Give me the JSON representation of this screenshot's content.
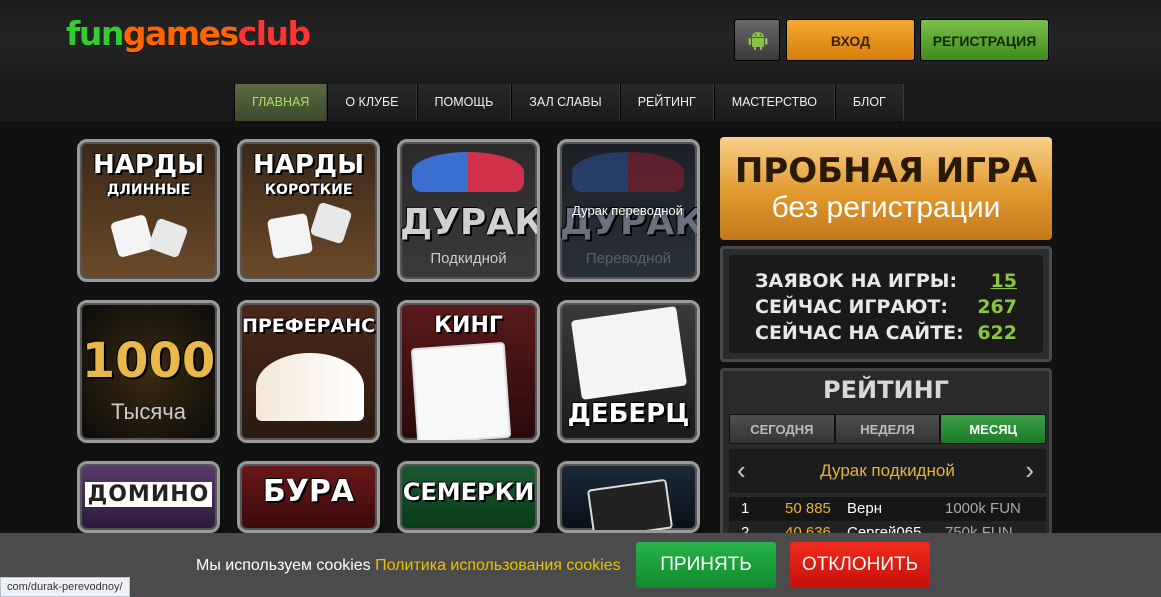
{
  "header": {
    "logo": {
      "parts": [
        "fun",
        "games",
        "club"
      ],
      "colors": [
        "#33cc33",
        "#ff6600",
        "#ff3333"
      ]
    },
    "android_icon": "android-icon",
    "login_label": "ВХОД",
    "register_label": "РЕГИСТРАЦИЯ"
  },
  "nav": {
    "items": [
      "ГЛАВНАЯ",
      "О КЛУБЕ",
      "ПОМОЩЬ",
      "ЗАЛ СЛАВЫ",
      "РЕЙТИНГ",
      "МАСТЕРСТВО",
      "БЛОГ"
    ],
    "active": "ГЛАВНАЯ"
  },
  "games": [
    {
      "title": "НАРДЫ",
      "sub": "ДЛИННЫЕ"
    },
    {
      "title": "НАРДЫ",
      "sub": "КОРОТКИЕ"
    },
    {
      "title": "ДУРАК",
      "sub": "Подкидной"
    },
    {
      "title": "ДУРАК",
      "sub": "Переводной"
    },
    {
      "title": "1000",
      "sub": "Тысяча"
    },
    {
      "title": "ПРЕФЕРАНС",
      "sub": ""
    },
    {
      "title": "КИНГ",
      "sub": ""
    },
    {
      "title": "ДЕБЕРЦ",
      "sub": ""
    },
    {
      "title": "ДОМИНО",
      "sub": ""
    },
    {
      "title": "БУРА",
      "sub": ""
    },
    {
      "title": "СЕМЕРКИ",
      "sub": ""
    },
    {
      "title": "",
      "sub": ""
    }
  ],
  "hover_tooltip": "Дурак переводной",
  "promo": {
    "line1": "ПРОБНАЯ ИГРА",
    "line2": "без регистрации"
  },
  "stats": [
    {
      "label": "ЗАЯВОК НА ИГРЫ:",
      "value": "15"
    },
    {
      "label": "СЕЙЧАС ИГРАЮТ:",
      "value": "267"
    },
    {
      "label": "СЕЙЧАС НА САЙТЕ:",
      "value": "622"
    }
  ],
  "rating": {
    "title": "РЕЙТИНГ",
    "tabs": [
      "СЕГОДНЯ",
      "НЕДЕЛЯ",
      "МЕСЯЦ"
    ],
    "active_tab": "МЕСЯЦ",
    "game": "Дурак подкидной",
    "rows": [
      {
        "rank": "1",
        "score": "50 885",
        "name": "Верн",
        "fun": "1000k FUN"
      },
      {
        "rank": "2",
        "score": "40 636",
        "name": "Сергей065",
        "fun": "750k FUN"
      }
    ]
  },
  "cookie": {
    "text": "Мы используем cookies",
    "link": "Политика использования cookies",
    "accept": "ПРИНЯТЬ",
    "decline": "ОТКЛОНИТЬ"
  },
  "status_url": "com/durak-perevodnoy/"
}
